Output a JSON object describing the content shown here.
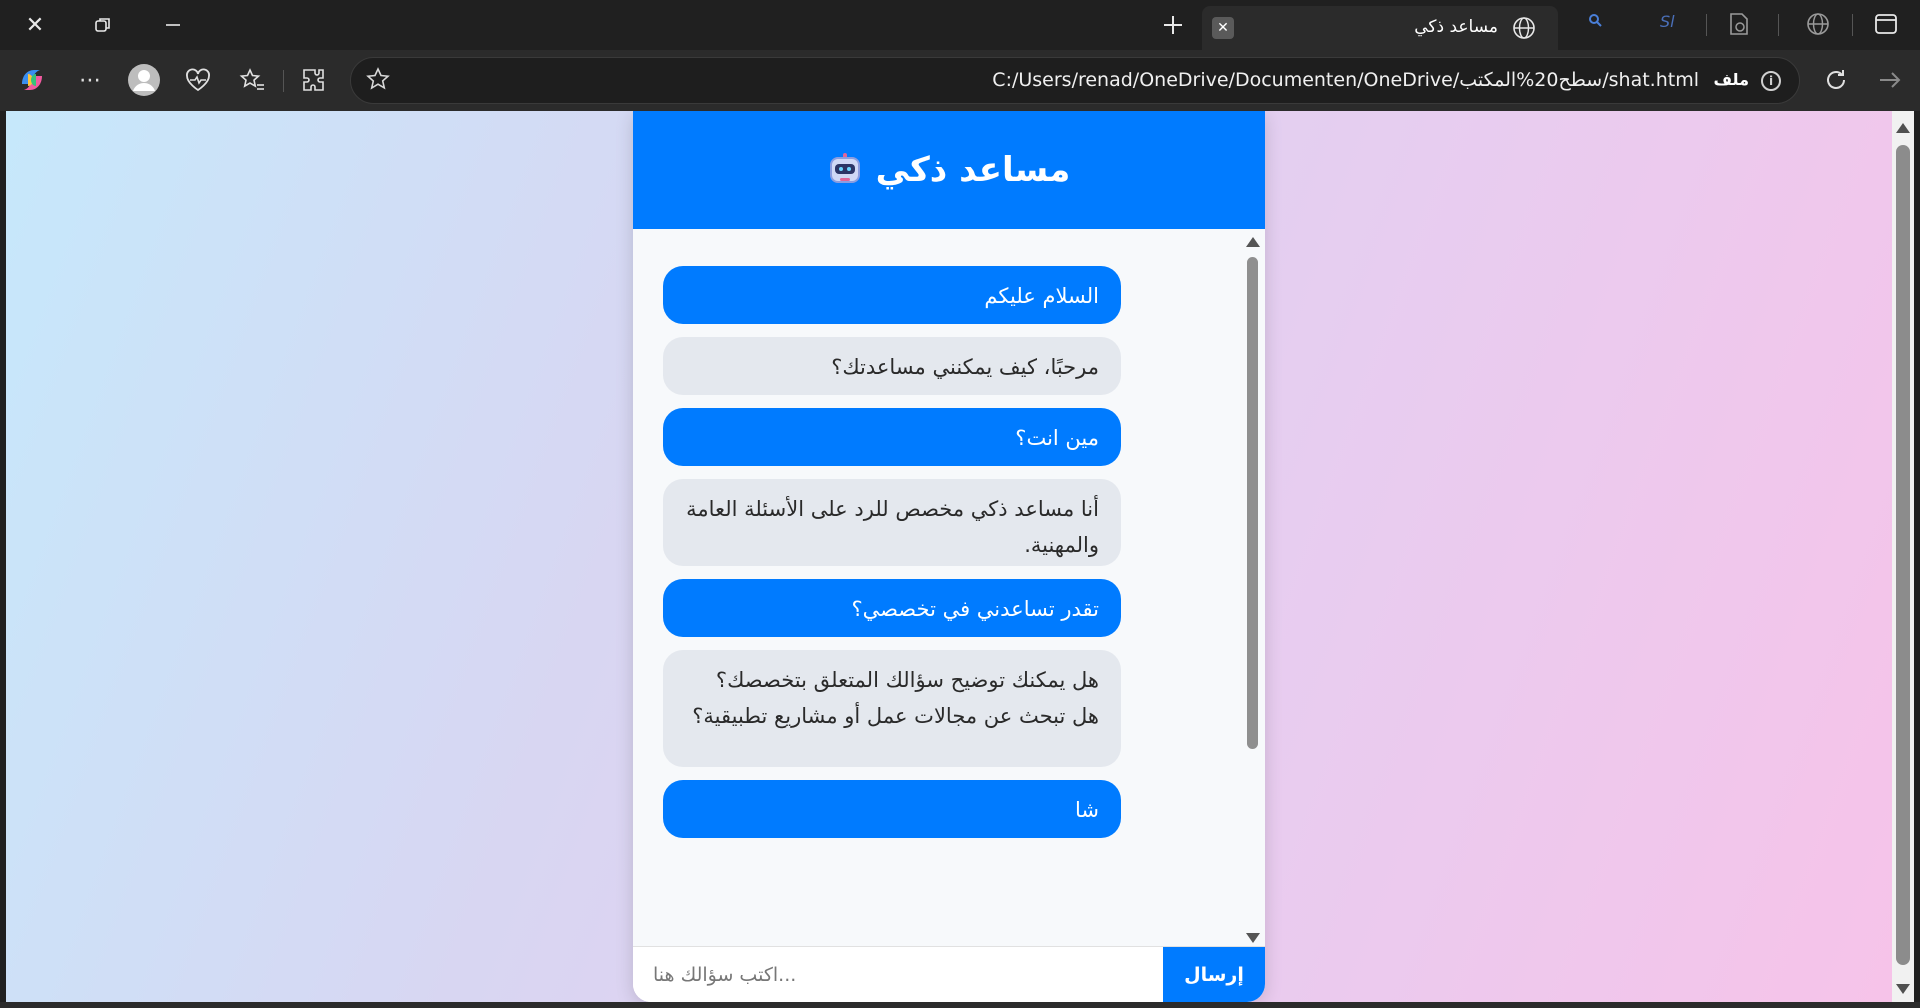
{
  "browser": {
    "tab_title": "مساعد ذكي",
    "inactive_tab_text": "Sl",
    "address_prefix": "ملف",
    "url": "C:/Users/renad/OneDrive/Documenten/OneDrive/سطح20%المكتب/shat.html"
  },
  "chat": {
    "title": "مساعد ذكي",
    "messages": [
      {
        "role": "user",
        "text": "السلام عليكم"
      },
      {
        "role": "bot",
        "text": "مرحبًا، كيف يمكنني مساعدتك؟"
      },
      {
        "role": "user",
        "text": "مين انت؟"
      },
      {
        "role": "bot",
        "text": "أنا مساعد ذكي مخصص للرد على الأسئلة العامة والمهنية."
      },
      {
        "role": "user",
        "text": "تقدر تساعدني في تخصصي؟"
      },
      {
        "role": "bot",
        "text": "هل يمكنك توضيح سؤالك المتعلق بتخصصك؟ هل تبحث عن مجالات عمل أو مشاريع تطبيقية؟"
      },
      {
        "role": "user",
        "text": "شا"
      }
    ],
    "input_placeholder": "...اكتب سؤالك هنا",
    "send_label": "إرسال"
  },
  "colors": {
    "accent": "#007bff",
    "bot_bubble": "#e4e8ee"
  }
}
